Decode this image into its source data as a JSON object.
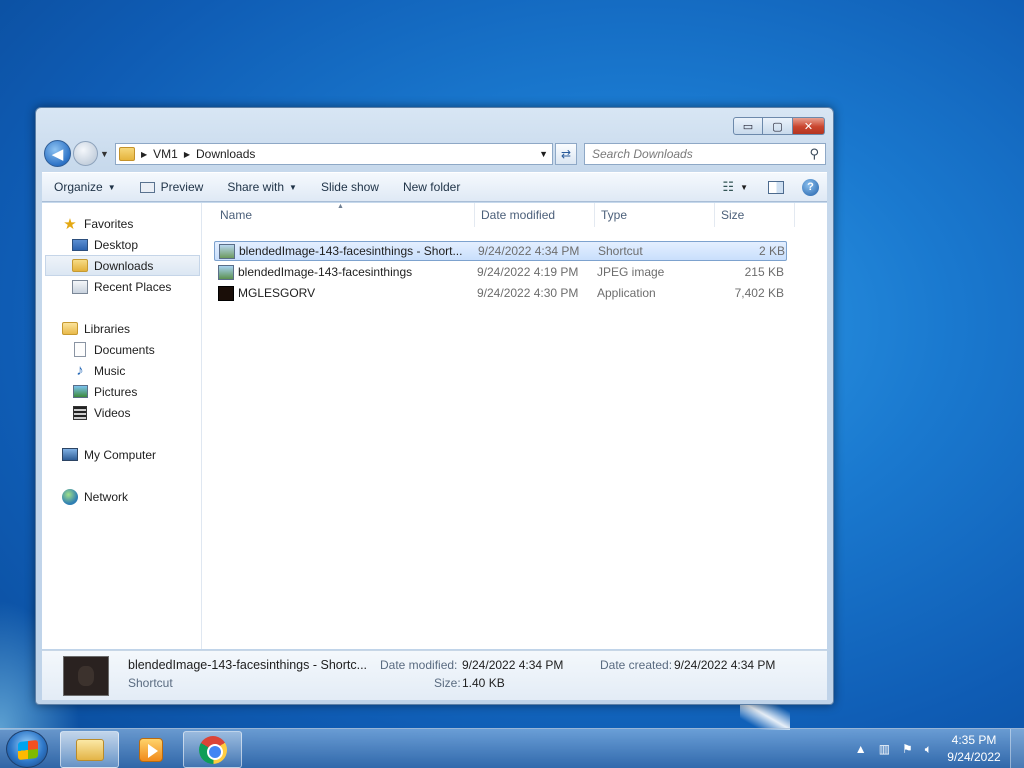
{
  "window": {
    "controls": {
      "minimize": "▭",
      "maximize": "▢",
      "close": "✕"
    }
  },
  "address_bar": {
    "back_glyph": "◀",
    "breadcrumbs": [
      "VM1",
      "Downloads"
    ],
    "search_placeholder": "Search Downloads"
  },
  "toolbar": {
    "organize": "Organize",
    "preview": "Preview",
    "share_with": "Share with",
    "slide_show": "Slide show",
    "new_folder": "New folder"
  },
  "nav_pane": {
    "favorites": "Favorites",
    "desktop": "Desktop",
    "downloads": "Downloads",
    "recent_places": "Recent Places",
    "libraries": "Libraries",
    "documents": "Documents",
    "music": "Music",
    "pictures": "Pictures",
    "videos": "Videos",
    "my_computer": "My Computer",
    "network": "Network"
  },
  "file_list": {
    "columns": [
      "Name",
      "Date modified",
      "Type",
      "Size"
    ],
    "rows": [
      {
        "name": "blendedImage-143-facesinthings - Short...",
        "date": "9/24/2022 4:34 PM",
        "type": "Shortcut",
        "size": "2 KB",
        "icon": "shortcut-icon",
        "selected": true
      },
      {
        "name": "blendedImage-143-facesinthings",
        "date": "9/24/2022 4:19 PM",
        "type": "JPEG image",
        "size": "215 KB",
        "icon": "jpeg-icon",
        "selected": false
      },
      {
        "name": "MGLESGORV",
        "date": "9/24/2022 4:30 PM",
        "type": "Application",
        "size": "7,402 KB",
        "icon": "application-icon",
        "selected": false
      }
    ]
  },
  "details": {
    "name": "blendedImage-143-facesinthings - Shortc...",
    "type": "Shortcut",
    "date_modified_label": "Date modified:",
    "date_modified": "9/24/2022 4:34 PM",
    "size_label": "Size:",
    "size": "1.40 KB",
    "date_created_label": "Date created:",
    "date_created": "9/24/2022 4:34 PM"
  },
  "taskbar": {
    "time": "4:35 PM",
    "date": "9/24/2022"
  }
}
